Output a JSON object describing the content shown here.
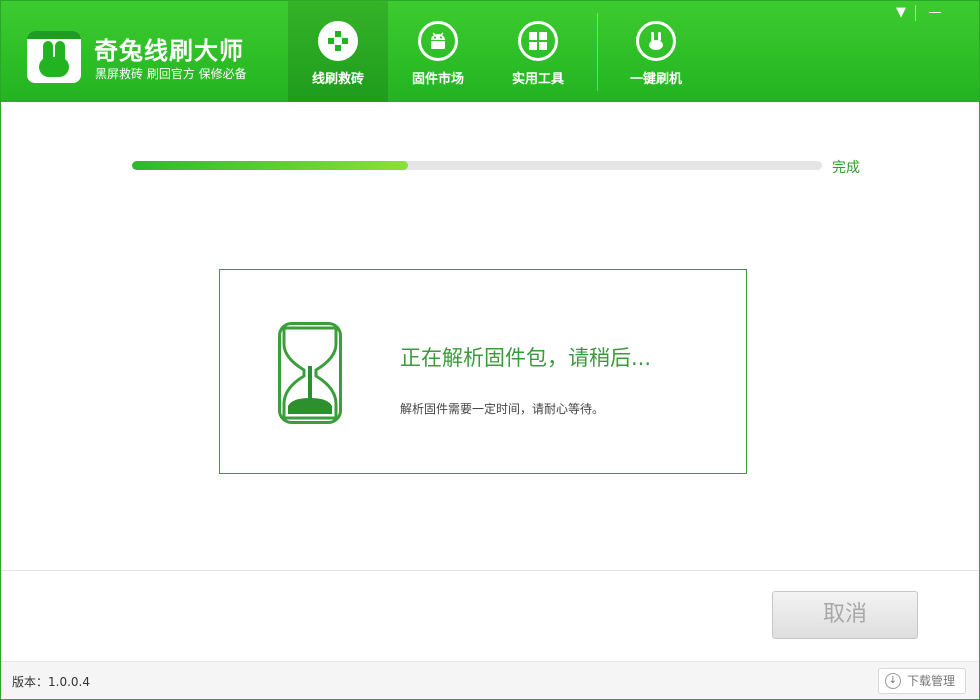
{
  "app": {
    "title": "奇兔线刷大师",
    "subtitle": "黑屏救砖 刷回官方 保修必备"
  },
  "nav": {
    "items": [
      {
        "label": "线刷救砖",
        "icon": "plus-cross-icon",
        "active": true
      },
      {
        "label": "固件市场",
        "icon": "android-icon",
        "active": false
      },
      {
        "label": "实用工具",
        "icon": "grid-icon",
        "active": false
      },
      {
        "label": "一键刷机",
        "icon": "rabbit-icon",
        "active": false
      }
    ]
  },
  "window_controls": {
    "menu": "▼",
    "minimize": "—"
  },
  "progress": {
    "value_fraction": 0.4,
    "end_label": "完成"
  },
  "status": {
    "title": "正在解析固件包，请稍后...",
    "description": "解析固件需要一定时间，请耐心等待。"
  },
  "footer": {
    "cancel_label": "取消",
    "version": "版本：1.0.0.4",
    "download_label": "下载管理"
  },
  "colors": {
    "brand_green": "#22b321",
    "accent_text": "#3c9a3c"
  }
}
